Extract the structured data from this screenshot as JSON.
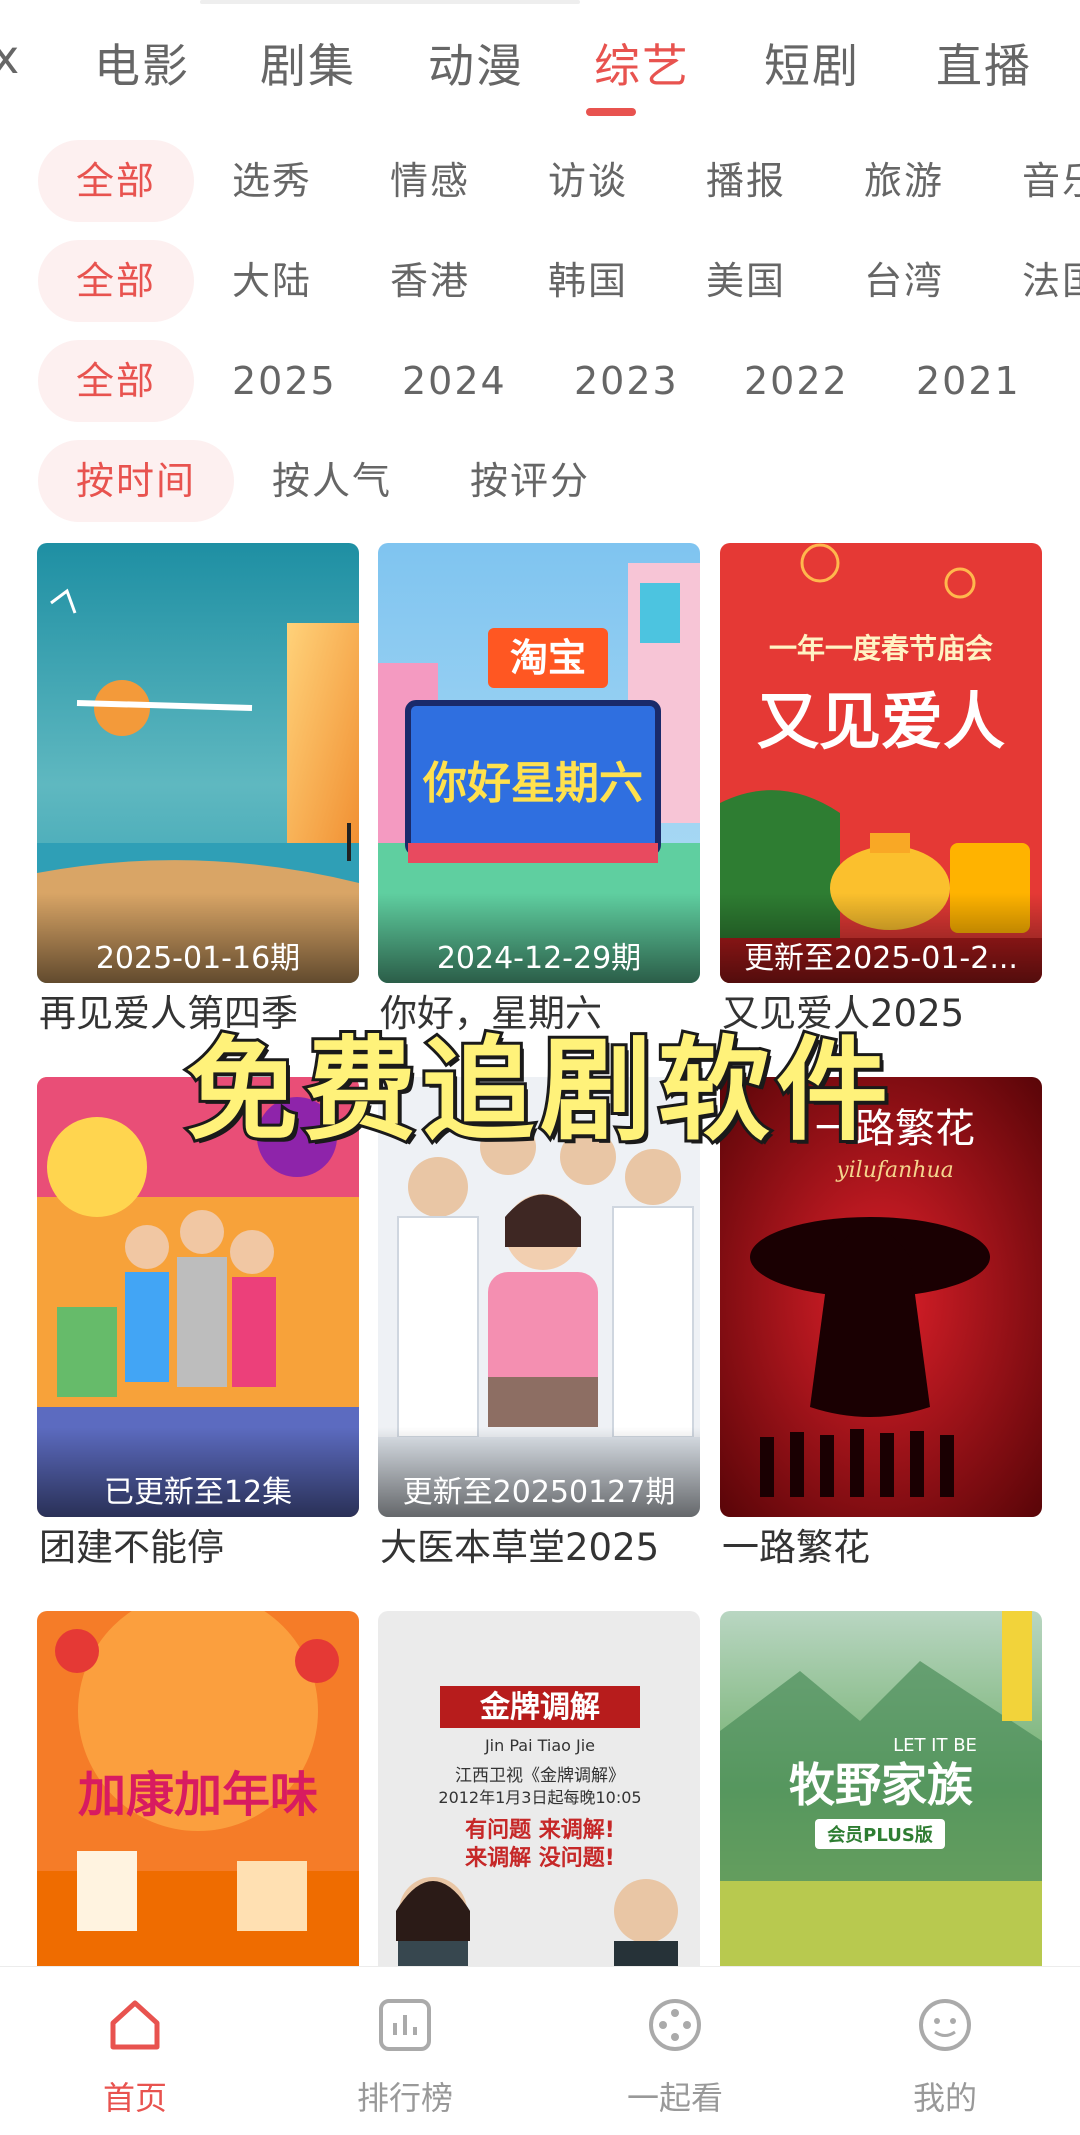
{
  "top_tabs": [
    {
      "label": "x"
    },
    {
      "label": "电影"
    },
    {
      "label": "剧集"
    },
    {
      "label": "动漫"
    },
    {
      "label": "综艺",
      "active": true
    },
    {
      "label": "短剧"
    },
    {
      "label": "直播"
    }
  ],
  "filters": {
    "genre": [
      "全部",
      "选秀",
      "情感",
      "访谈",
      "播报",
      "旅游",
      "音乐"
    ],
    "region": [
      "全部",
      "大陆",
      "香港",
      "韩国",
      "美国",
      "台湾",
      "法国"
    ],
    "year": [
      "全部",
      "2025",
      "2024",
      "2023",
      "2022",
      "2021"
    ],
    "sort": [
      "按时间",
      "按人气",
      "按评分"
    ]
  },
  "cards": [
    {
      "title": "再见爱人第四季",
      "badge": "2025-01-16期"
    },
    {
      "title": "你好，星期六",
      "badge": "2024-12-29期"
    },
    {
      "title": "又见爱人2025",
      "badge": "更新至2025-01-2..."
    },
    {
      "title": "团建不能停",
      "badge": "已更新至12集"
    },
    {
      "title": "大医本草堂2025",
      "badge": "更新至20250127期"
    },
    {
      "title": "一路繁花",
      "badge": ""
    },
    {
      "title": "",
      "badge": ""
    },
    {
      "title": "",
      "badge": ""
    },
    {
      "title": "",
      "badge": ""
    }
  ],
  "poster_text": {
    "p2_brand": "淘宝",
    "p2_title": "你好星期六",
    "p3_top": "一年一度春节庙会",
    "p3_main": "又见爱人",
    "p6_main": "一路繁花",
    "p6_sub": "yilufanhua",
    "p7_main": "加康加年味",
    "p8_brand": "金牌调解",
    "p8_pinyin": "Jin Pai   Tiao Jie",
    "p8_line1": "江西卫视《金牌调解》",
    "p8_line2": "2012年1月3日起每晚10:05",
    "p8_slogan1": "有问题 来调解!",
    "p8_slogan2": "来调解 没问题!",
    "p9_main": "牧野家族",
    "p9_tag": "会员PLUS版",
    "p9_en": "LET IT BE"
  },
  "overlay": {
    "caption": "免费追剧软件"
  },
  "bottom_nav": [
    {
      "label": "首页",
      "icon": "home-icon",
      "active": true
    },
    {
      "label": "排行榜",
      "icon": "ranking-icon"
    },
    {
      "label": "一起看",
      "icon": "watch-together-icon"
    },
    {
      "label": "我的",
      "icon": "profile-icon"
    }
  ],
  "colors": {
    "accent": "#e8534f",
    "chip_bg": "#fdf0f0",
    "inactive": "#666666"
  }
}
